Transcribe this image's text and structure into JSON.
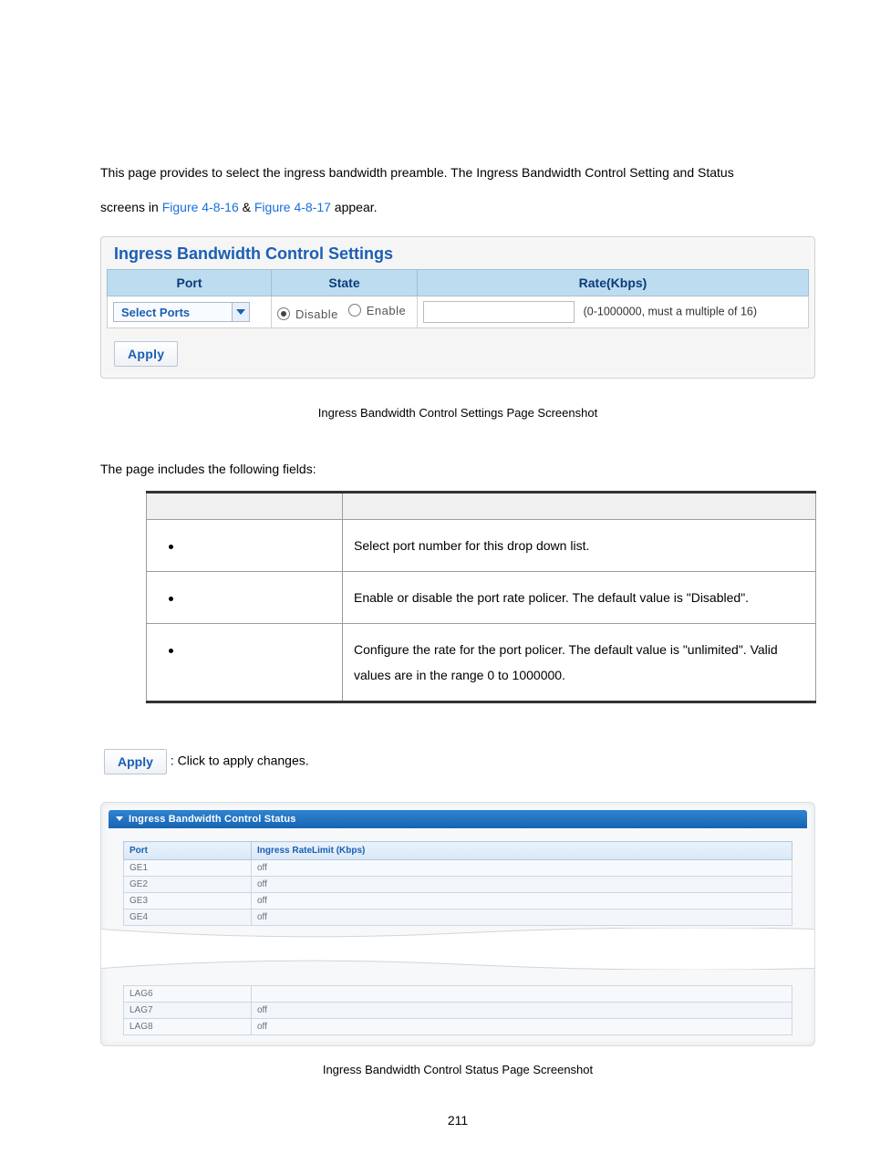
{
  "intro": {
    "line1_a": "This page provides to select the ingress bandwidth preamble. The Ingress Bandwidth Control Setting and Status",
    "line2_a": "screens in ",
    "xref1": "Figure 4-8-16",
    "amp": " & ",
    "xref2": "Figure 4-8-17",
    "line2_b": " appear."
  },
  "settings": {
    "panel_title": "Ingress Bandwidth Control Settings",
    "headers": {
      "port": "Port",
      "state": "State",
      "rate": "Rate(Kbps)"
    },
    "port_placeholder": "Select Ports",
    "state": {
      "disable": "Disable",
      "enable": "Enable",
      "selected": "disable"
    },
    "rate_hint": "(0-1000000, must a multiple of 16)",
    "apply_label": "Apply"
  },
  "caption1": "Ingress Bandwidth Control Settings Page Screenshot",
  "fields_intro": "The page includes the following fields:",
  "desc_rows": [
    {
      "text": "Select port number for this drop down list."
    },
    {
      "text": "Enable or disable the port rate policer. The default value is \"Disabled\"."
    },
    {
      "text": "Configure the rate for the port policer. The default value is \"unlimited\". Valid values are in the range 0 to 1000000."
    }
  ],
  "apply_inline": "Apply",
  "apply_inline_text": ": Click to apply changes.",
  "status": {
    "header": "Ingress Bandwidth Control Status",
    "cols": {
      "port": "Port",
      "rate": "Ingress RateLimit (Kbps)"
    },
    "rows_top": [
      {
        "port": "GE1",
        "rate": "off"
      },
      {
        "port": "GE2",
        "rate": "off"
      },
      {
        "port": "GE3",
        "rate": "off"
      },
      {
        "port": "GE4",
        "rate": "off"
      }
    ],
    "rows_bottom": [
      {
        "port": "LAG6",
        "rate": ""
      },
      {
        "port": "LAG7",
        "rate": "off"
      },
      {
        "port": "LAG8",
        "rate": "off"
      }
    ]
  },
  "caption2": "Ingress Bandwidth Control Status Page Screenshot",
  "page_number": "211"
}
